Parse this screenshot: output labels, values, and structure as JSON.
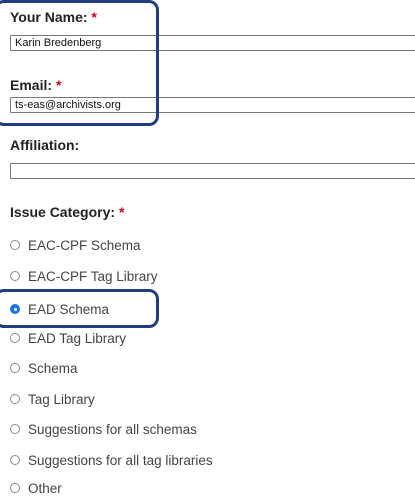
{
  "form": {
    "name": {
      "label": "Your Name:",
      "required": "*",
      "value": "Karin Bredenberg"
    },
    "email": {
      "label": "Email:",
      "required": "*",
      "value": "ts-eas@archivists.org"
    },
    "affiliation": {
      "label": "Affiliation:",
      "value": ""
    },
    "issue_category": {
      "label": "Issue Category:",
      "required": "*",
      "selected": "EAD Schema",
      "options": [
        {
          "label": "EAC-CPF Schema"
        },
        {
          "label": "EAC-CPF Tag Library"
        },
        {
          "label": "EAD Schema"
        },
        {
          "label": "EAD Tag Library"
        },
        {
          "label": "Schema"
        },
        {
          "label": "Tag Library"
        },
        {
          "label": "Suggestions for all schemas"
        },
        {
          "label": "Suggestions for all tag libraries"
        },
        {
          "label": "Other"
        }
      ]
    }
  },
  "colors": {
    "highlight_border": "#1f3d80",
    "required_marker": "#d0021b",
    "radio_selected": "#1a73e8"
  }
}
